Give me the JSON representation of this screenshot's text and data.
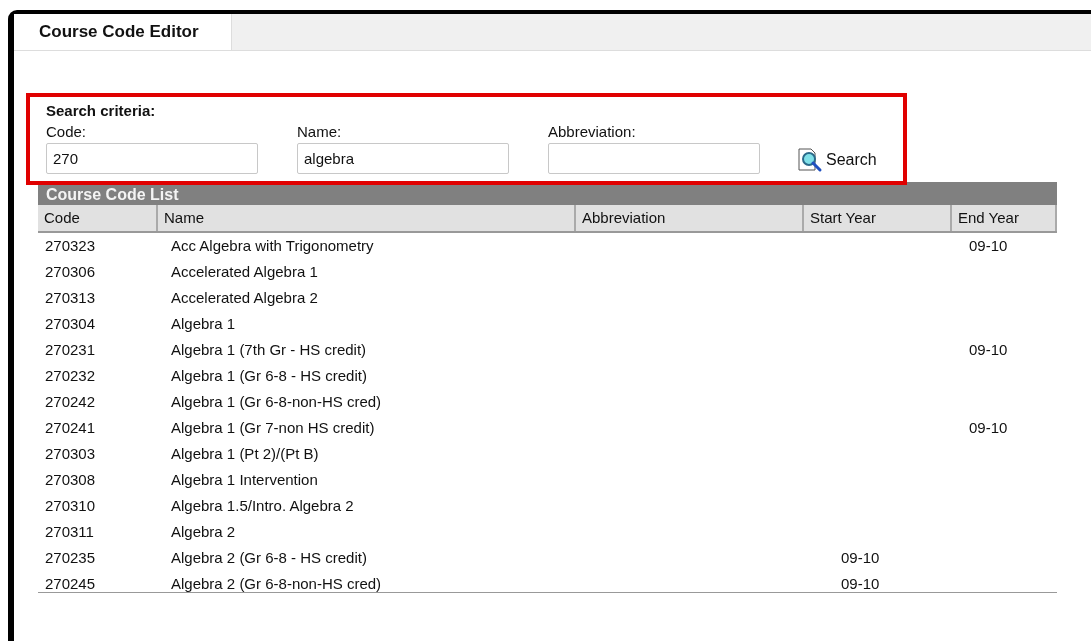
{
  "tabs": [
    {
      "label": "Course Code Editor",
      "selected": true
    }
  ],
  "search": {
    "title": "Search criteria:",
    "fields": [
      {
        "label": "Code:",
        "value": "270"
      },
      {
        "label": "Name:",
        "value": "algebra"
      },
      {
        "label": "Abbreviation:"
      }
    ],
    "button": "Search"
  },
  "list": {
    "title": "Course Code List",
    "columns": [
      "Code",
      "Name",
      "Abbreviation",
      "Start Year",
      "End Year"
    ],
    "rows": [
      {
        "code": "270323",
        "name": "Acc Algebra with Trigonometry",
        "end_year": "09-10"
      },
      {
        "code": "270306",
        "name": "Accelerated Algebra 1"
      },
      {
        "code": "270313",
        "name": "Accelerated Algebra 2"
      },
      {
        "code": "270304",
        "name": "Algebra 1"
      },
      {
        "code": "270231",
        "name": "Algebra 1 (7th Gr - HS credit)",
        "end_year": "09-10"
      },
      {
        "code": "270232",
        "name": "Algebra 1 (Gr 6-8 - HS credit)"
      },
      {
        "code": "270242",
        "name": "Algebra 1 (Gr 6-8-non-HS cred)"
      },
      {
        "code": "270241",
        "name": "Algebra 1 (Gr 7-non HS credit)",
        "end_year": "09-10"
      },
      {
        "code": "270303",
        "name": "Algebra 1 (Pt 2)/(Pt B)"
      },
      {
        "code": "270308",
        "name": "Algebra 1 Intervention"
      },
      {
        "code": "270310",
        "name": "Algebra 1.5/Intro. Algebra 2"
      },
      {
        "code": "270311",
        "name": "Algebra 2"
      },
      {
        "code": "270235",
        "name": "Algebra 2 (Gr 6-8 - HS credit)",
        "start_year": "09-10"
      },
      {
        "code": "270245",
        "name": "Algebra 2 (Gr 6-8-non-HS cred)",
        "start_year": "09-10"
      }
    ]
  }
}
